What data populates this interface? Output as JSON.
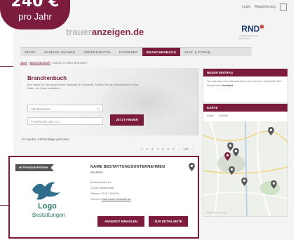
{
  "price_badge": {
    "amount": "240 €",
    "period": "pro Jahr"
  },
  "topbar": {
    "items": [
      "Login",
      "Registrierung"
    ]
  },
  "logo": {
    "prefix": "trauer",
    "suffix": "anzeigen.de"
  },
  "partner": {
    "name": "RND",
    "subtitle": "RedaktionsNetzwerk Deutschland"
  },
  "nav": {
    "items": [
      "START",
      "ANZEIGE SUCHEN",
      "GEDENKSEITEN",
      "RATGEBER",
      "BRANCHENBUCH",
      "STAT. & FORUM"
    ],
    "active": "BRANCHENBUCH"
  },
  "breadcrumb": {
    "home": "Start",
    "section": "Branchenbuch",
    "current": "Suche in allen Branchen"
  },
  "hero": {
    "title": "Branchenbuch",
    "text": "Ihre Helfer für Ihre persönliche Vorsorge im Trauerfall. Finden Sie die Dienstleister in Ihrer Nähe, die Ihnen beistehen.",
    "select_value": "Alle Branchen",
    "place_placeholder": "Postleitzahl oder Ort",
    "search_label": "JETZT FINDEN"
  },
  "results": {
    "count_text": "Es wurden 148 Einträge gefunden"
  },
  "pagination": {
    "pages": [
      "1",
      "2",
      "3",
      "4",
      "5",
      "6",
      "7",
      "..",
      "148",
      "›"
    ]
  },
  "listing": {
    "badge": "Premium-Partner",
    "logo_word": "Logo",
    "logo_sub": "Bestattungen",
    "name": "NAME BESTATTUNGSUNTERNEHMEN",
    "subname": "Bestatter",
    "street": "Musterstraße 14",
    "city": "12345 Musterstadt",
    "phone": "Telefon: 0123 / 456789",
    "web_label": "Internet:",
    "web_url": "www.name-bestatter.de",
    "primary_button": "ANGEBOT EINHOLEN",
    "secondary_button": "ZUR DETAILSEITE"
  },
  "sidebar": {
    "box_title": "NEUER EINTRAG",
    "box_text": "Sie betreiben ein Unternehmen rund um den Trauerfall? Ihre Firma fehlt?",
    "box_link": "Kontakt",
    "map_title": "KARTE",
    "map_tabs": [
      "Karte",
      "Satellit"
    ],
    "map_footer": "Kartendaten © Google"
  },
  "colors": {
    "brand": "#7b1c3e",
    "logo_green": "#2e7d6b",
    "partner_blue": "#1f3b73"
  }
}
